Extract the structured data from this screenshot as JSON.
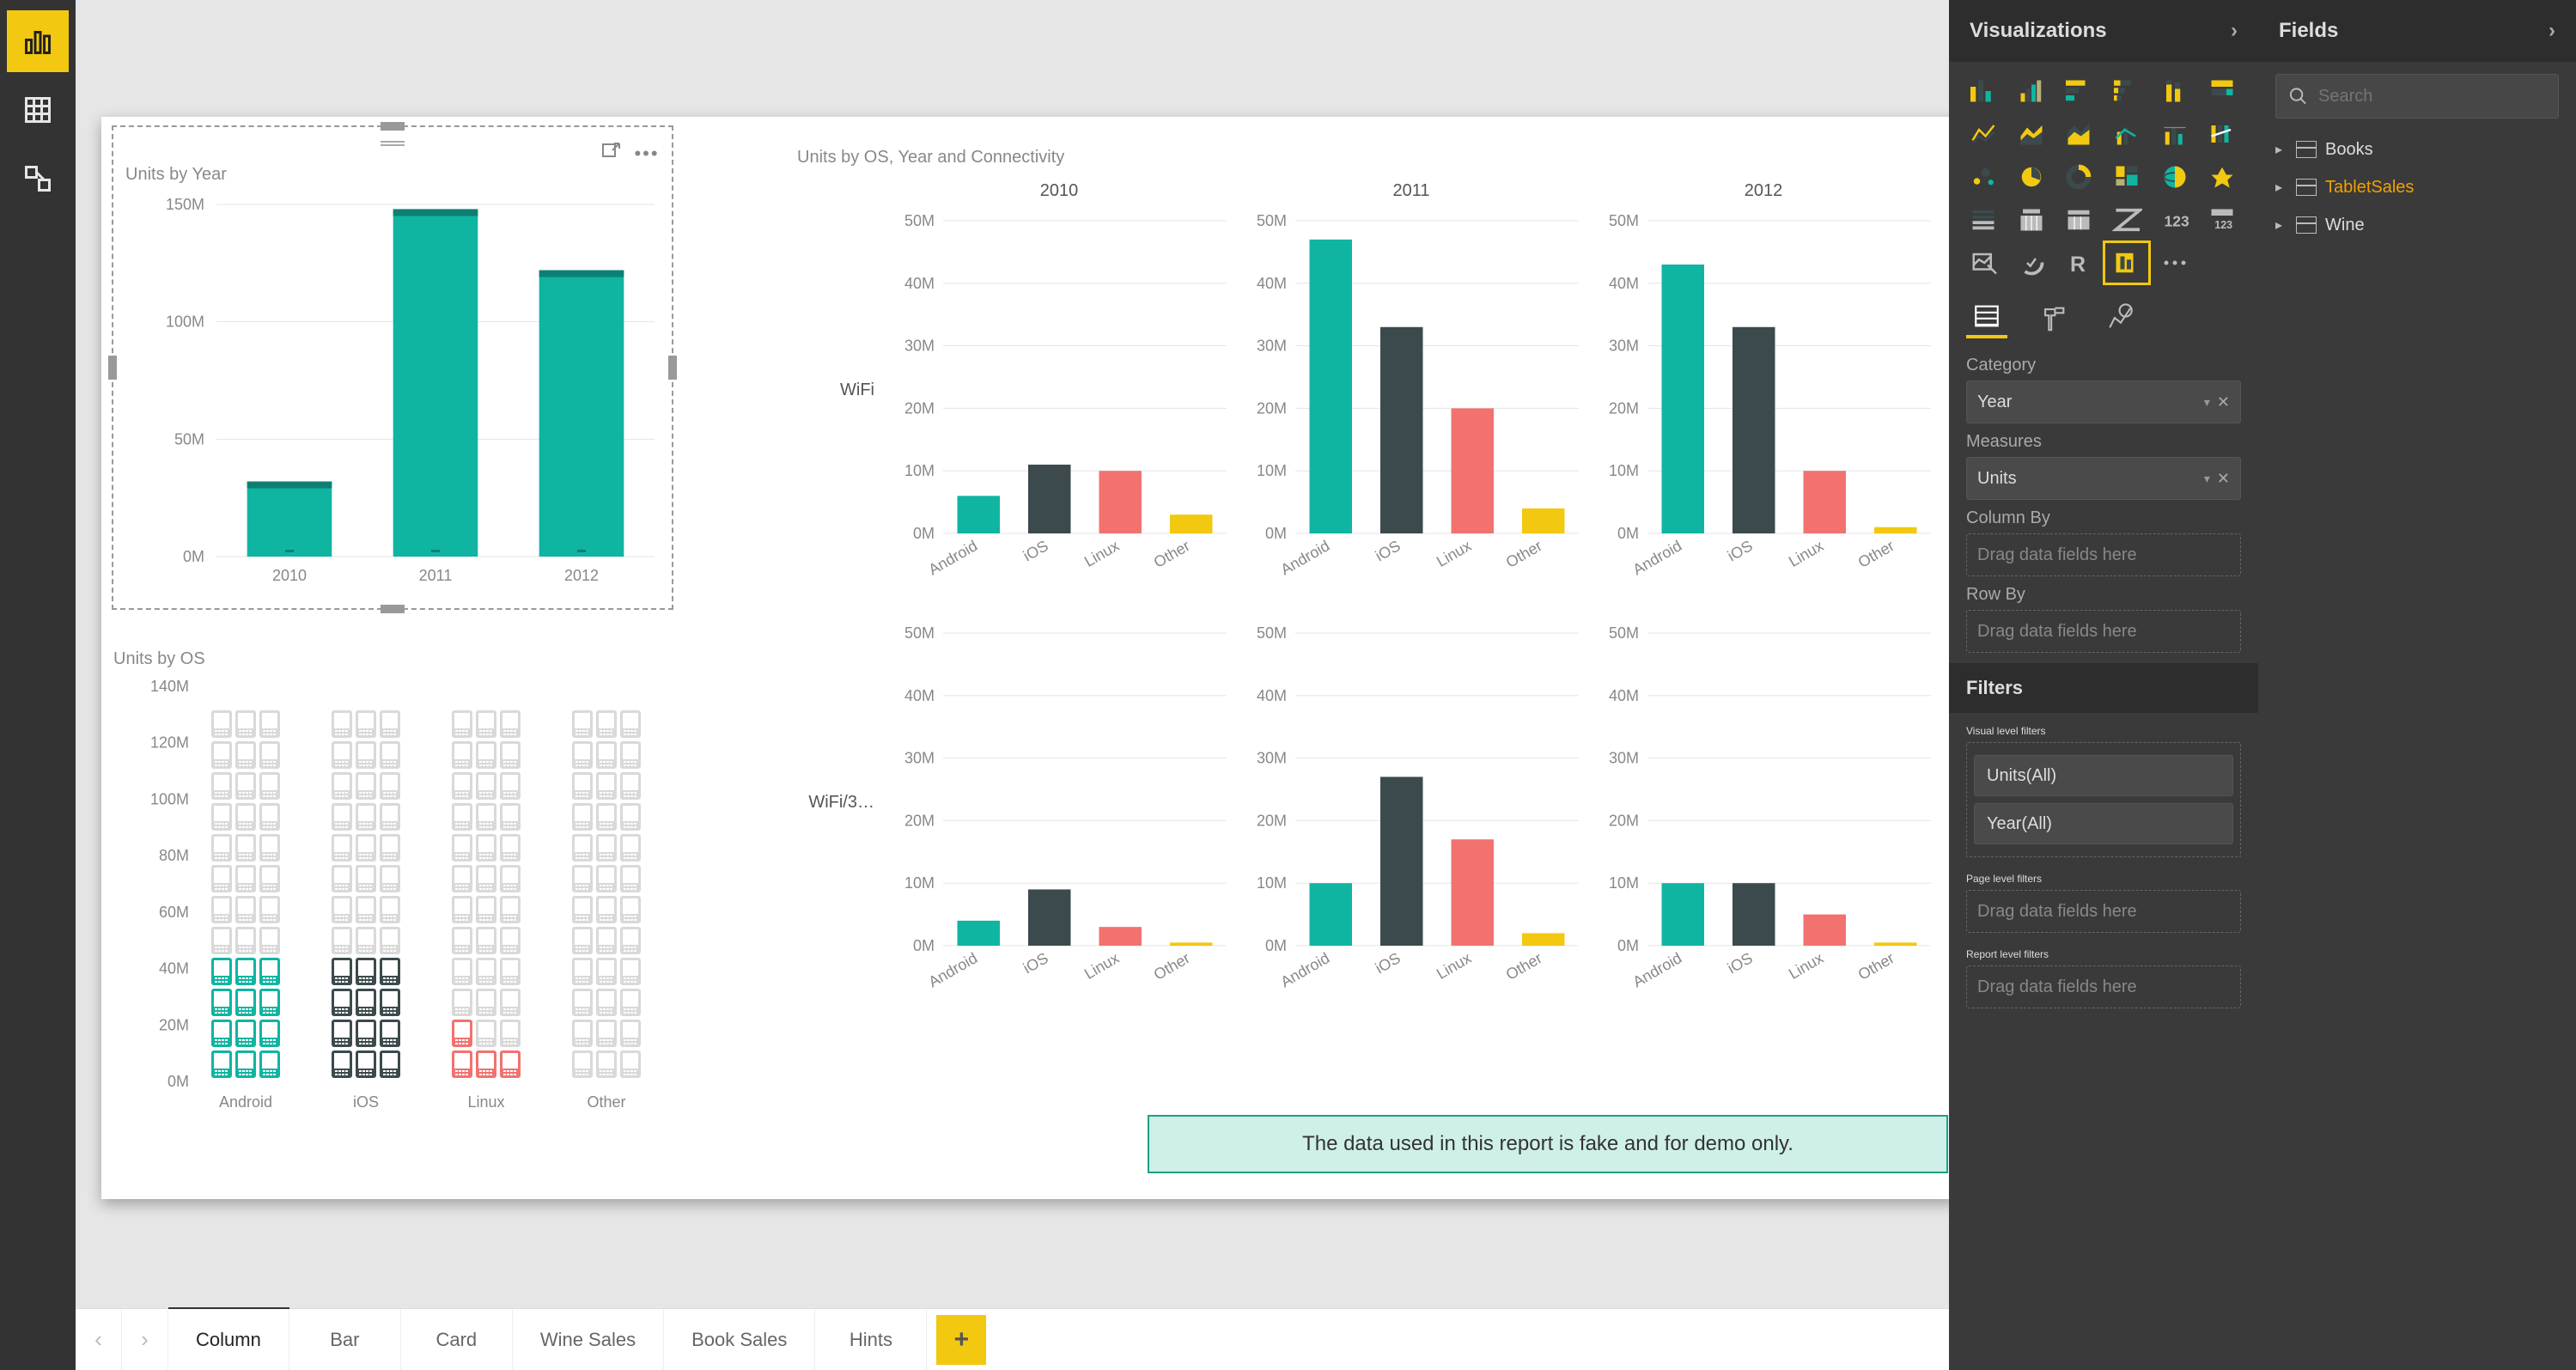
{
  "app": {
    "panes": {
      "viz_title": "Visualizations",
      "fields_title": "Fields",
      "filters_title": "Filters"
    },
    "search": {
      "placeholder": "Search"
    }
  },
  "nav": {
    "items": [
      {
        "name": "report-icon",
        "active": true
      },
      {
        "name": "data-icon",
        "active": false
      },
      {
        "name": "model-icon",
        "active": false
      }
    ]
  },
  "tabs": [
    {
      "label": "Column",
      "active": true
    },
    {
      "label": "Bar",
      "active": false
    },
    {
      "label": "Card",
      "active": false
    },
    {
      "label": "Wine Sales",
      "active": false
    },
    {
      "label": "Book Sales",
      "active": false
    },
    {
      "label": "Hints",
      "active": false
    }
  ],
  "datasets": [
    {
      "label": "Books",
      "active": false
    },
    {
      "label": "TabletSales",
      "active": true
    },
    {
      "label": "Wine",
      "active": false
    }
  ],
  "wells": {
    "category_label": "Category",
    "category_value": "Year",
    "measures_label": "Measures",
    "measures_value": "Units",
    "columnby_label": "Column By",
    "columnby_placeholder": "Drag data fields here",
    "rowby_label": "Row By",
    "rowby_placeholder": "Drag data fields here"
  },
  "filters": {
    "visual_label": "Visual level filters",
    "visual_items": [
      "Units(All)",
      "Year(All)"
    ],
    "page_label": "Page level filters",
    "page_placeholder": "Drag data fields here",
    "report_label": "Report level filters",
    "report_placeholder": "Drag data fields here"
  },
  "note": "The data used in this report is fake and for demo only.",
  "charts": {
    "unitsByYear": {
      "title": "Units by Year",
      "data": {
        "type": "bar",
        "categories": [
          "2010",
          "2011",
          "2012"
        ],
        "values": [
          32,
          148,
          122
        ],
        "ylabel_ticks": [
          "0M",
          "50M",
          "100M",
          "150M"
        ],
        "ymax": 150
      }
    },
    "unitsByOS": {
      "title": "Units by OS",
      "data": {
        "type": "pictogram-bar",
        "categories": [
          "Android",
          "iOS",
          "Linux",
          "Other"
        ],
        "values": [
          120,
          120,
          40,
          2
        ],
        "colors": [
          "#0fb5a1",
          "#3c4a4d",
          "#f1726f",
          "#f2c811"
        ],
        "ylabel_ticks": [
          "0M",
          "20M",
          "40M",
          "60M",
          "80M",
          "100M",
          "120M",
          "140M"
        ],
        "ymax": 140
      }
    },
    "smallMultiples": {
      "title": "Units by OS, Year and Connectivity",
      "rows": [
        "WiFi",
        "WiFi/3…"
      ],
      "cols": [
        "2010",
        "2011",
        "2012"
      ],
      "categories": [
        "Android",
        "iOS",
        "Linux",
        "Other"
      ],
      "colors": [
        "#0fb5a1",
        "#3c4a4d",
        "#f1726f",
        "#f2c811"
      ],
      "ymax": 50,
      "yticks": [
        "0M",
        "10M",
        "20M",
        "30M",
        "40M",
        "50M"
      ],
      "matrix": [
        [
          [
            6,
            11,
            10,
            3
          ],
          [
            47,
            33,
            20,
            4
          ],
          [
            43,
            33,
            10,
            1
          ]
        ],
        [
          [
            4,
            9,
            3,
            0.5
          ],
          [
            10,
            27,
            17,
            2
          ],
          [
            10,
            10,
            5,
            0.5
          ]
        ]
      ]
    }
  },
  "chart_data": [
    {
      "type": "bar",
      "title": "Units by Year",
      "categories": [
        "2010",
        "2011",
        "2012"
      ],
      "values": [
        32,
        148,
        122
      ],
      "ylabel": "",
      "xlabel": "",
      "ylim": [
        0,
        150
      ]
    },
    {
      "type": "bar",
      "title": "Units by OS",
      "categories": [
        "Android",
        "iOS",
        "Linux",
        "Other"
      ],
      "values": [
        120,
        120,
        40,
        2
      ],
      "ylim": [
        0,
        140
      ]
    },
    {
      "type": "bar",
      "title": "Units by OS, Year and Connectivity — WiFi / 2010",
      "categories": [
        "Android",
        "iOS",
        "Linux",
        "Other"
      ],
      "values": [
        6,
        11,
        10,
        3
      ],
      "ylim": [
        0,
        50
      ]
    },
    {
      "type": "bar",
      "title": "Units by OS, Year and Connectivity — WiFi / 2011",
      "categories": [
        "Android",
        "iOS",
        "Linux",
        "Other"
      ],
      "values": [
        47,
        33,
        20,
        4
      ],
      "ylim": [
        0,
        50
      ]
    },
    {
      "type": "bar",
      "title": "Units by OS, Year and Connectivity — WiFi / 2012",
      "categories": [
        "Android",
        "iOS",
        "Linux",
        "Other"
      ],
      "values": [
        43,
        33,
        10,
        1
      ],
      "ylim": [
        0,
        50
      ]
    },
    {
      "type": "bar",
      "title": "Units by OS, Year and Connectivity — WiFi/3G / 2010",
      "categories": [
        "Android",
        "iOS",
        "Linux",
        "Other"
      ],
      "values": [
        4,
        9,
        3,
        0.5
      ],
      "ylim": [
        0,
        50
      ]
    },
    {
      "type": "bar",
      "title": "Units by OS, Year and Connectivity — WiFi/3G / 2011",
      "categories": [
        "Android",
        "iOS",
        "Linux",
        "Other"
      ],
      "values": [
        10,
        27,
        17,
        2
      ],
      "ylim": [
        0,
        50
      ]
    },
    {
      "type": "bar",
      "title": "Units by OS, Year and Connectivity — WiFi/3G / 2012",
      "categories": [
        "Android",
        "iOS",
        "Linux",
        "Other"
      ],
      "values": [
        10,
        10,
        5,
        0.5
      ],
      "ylim": [
        0,
        50
      ]
    }
  ]
}
